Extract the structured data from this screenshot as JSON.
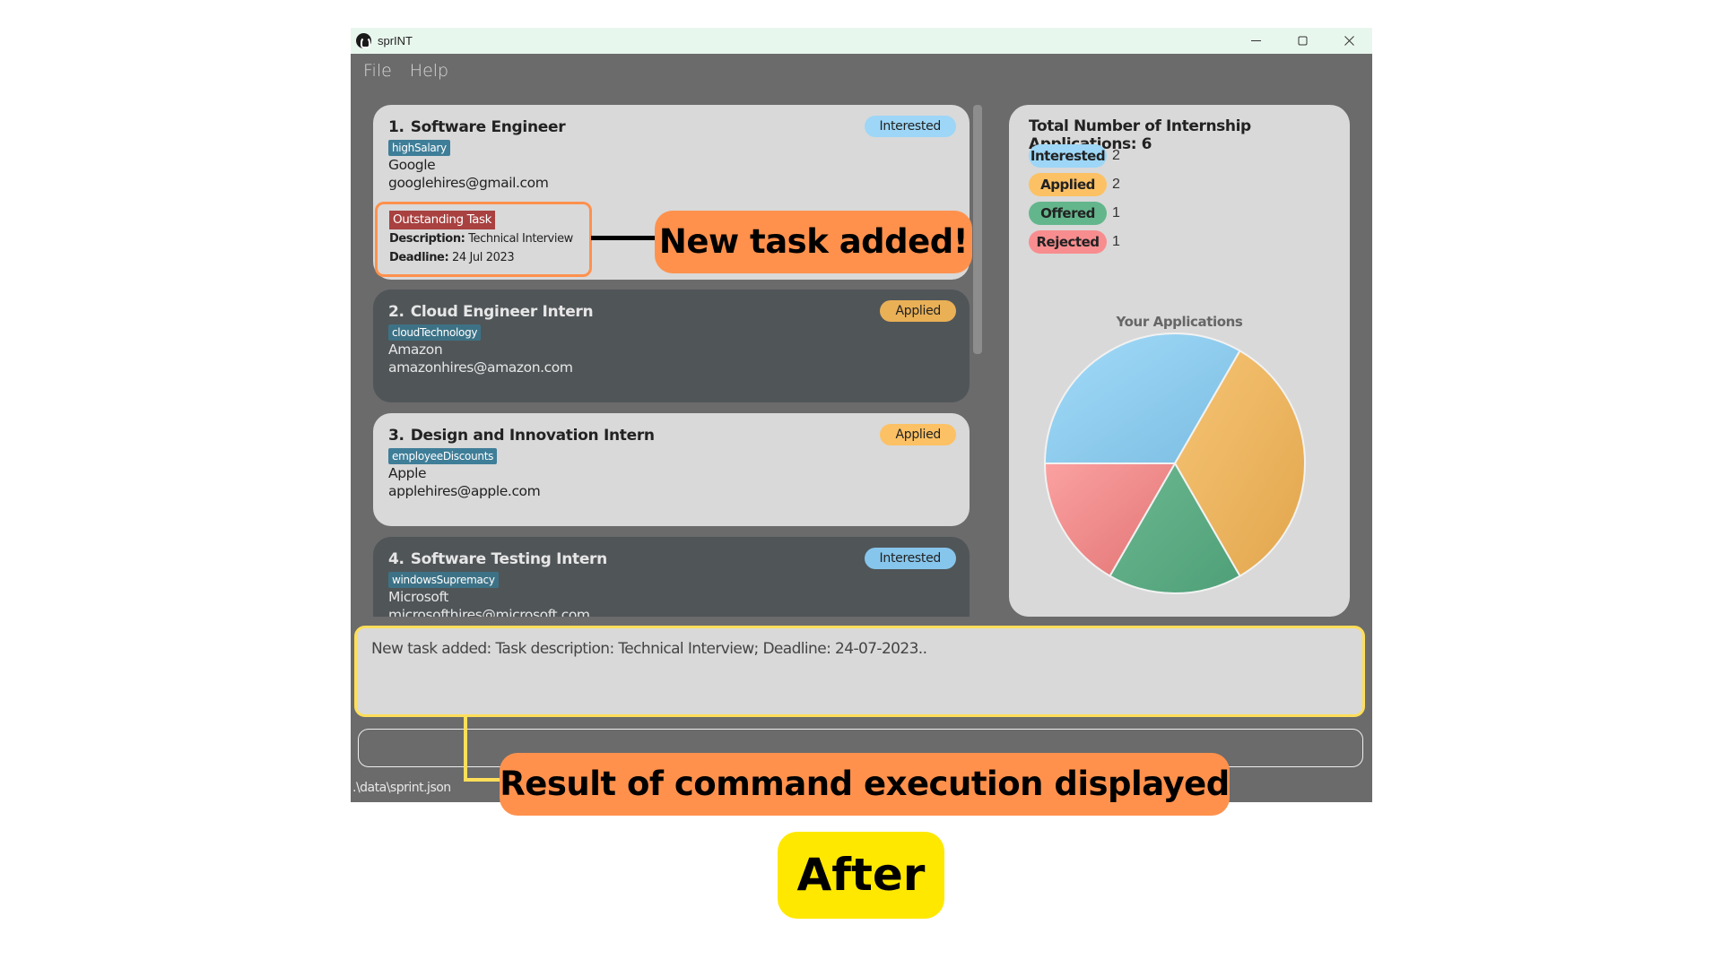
{
  "window": {
    "title": "sprINT",
    "controls": {
      "minimize": "minimize",
      "maximize": "maximize",
      "close": "close"
    }
  },
  "menu": {
    "items": [
      "File",
      "Help"
    ]
  },
  "applications": [
    {
      "index": "1.",
      "role": "Software Engineer",
      "tag": "highSalary",
      "company": "Google",
      "email": "googlehires@gmail.com",
      "status": "Interested",
      "task": {
        "badge": "Outstanding Task",
        "description_label": "Description:",
        "description": "Technical Interview",
        "deadline_label": "Deadline:",
        "deadline": "24 Jul 2023"
      }
    },
    {
      "index": "2.",
      "role": "Cloud Engineer Intern",
      "tag": "cloudTechnology",
      "company": "Amazon",
      "email": "amazonhires@amazon.com",
      "status": "Applied"
    },
    {
      "index": "3.",
      "role": "Design and Innovation Intern",
      "tag": "employeeDiscounts",
      "company": "Apple",
      "email": "applehires@apple.com",
      "status": "Applied"
    },
    {
      "index": "4.",
      "role": "Software Testing Intern",
      "tag": "windowsSupremacy",
      "company": "Microsoft",
      "email": "microsofthires@microsoft.com",
      "status": "Interested"
    }
  ],
  "stats": {
    "title": "Total Number of Internship Applications: 6",
    "rows": [
      {
        "label": "Interested",
        "count": "2",
        "color": "#9dd6f7"
      },
      {
        "label": "Applied",
        "count": "2",
        "color": "#fcc164"
      },
      {
        "label": "Offered",
        "count": "1",
        "color": "#63b68c"
      },
      {
        "label": "Rejected",
        "count": "1",
        "color": "#f88d8f"
      }
    ]
  },
  "chart_data": {
    "type": "pie",
    "title": "Your Applications",
    "categories": [
      "Interested",
      "Applied",
      "Offered",
      "Rejected"
    ],
    "values": [
      2,
      2,
      1,
      1
    ],
    "colors": [
      "#8ecdef",
      "#edb260",
      "#5aa880",
      "#ee8686"
    ],
    "legend": "none"
  },
  "result_display": {
    "text": "New task added: Task description: Technical Interview; Deadline: 24-07-2023.."
  },
  "command_box": {
    "value": "",
    "placeholder": ""
  },
  "status_bar": {
    "path": ".\\data\\sprint.json"
  },
  "annotations": {
    "task_callout": "New task added!",
    "result_callout": "Result of command execution displayed",
    "stage_label": "After"
  }
}
